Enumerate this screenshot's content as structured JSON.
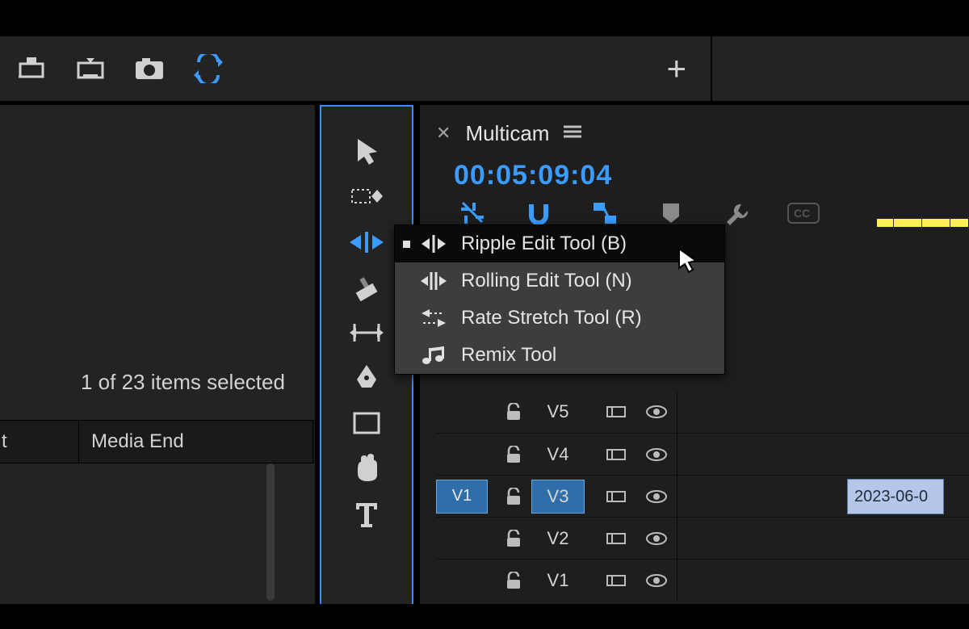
{
  "topbar": {
    "icons": [
      "export-marker-icon",
      "export-frame-icon",
      "camera-icon",
      "swap-icon"
    ],
    "plus": "+"
  },
  "project_panel": {
    "selection_text": "1 of 23 items selected",
    "columns": {
      "col1": "t",
      "col2": "Media End"
    }
  },
  "toolbar": {
    "tools": [
      "selection",
      "track-select",
      "ripple-edit",
      "razor",
      "slip",
      "pen",
      "rectangle",
      "hand",
      "type"
    ],
    "active_index": 2
  },
  "sequence": {
    "tab_title": "Multicam",
    "timecode": "00:05:09:04",
    "header_icons": [
      "insert-overwrite",
      "snap",
      "linked-selection",
      "marker",
      "wrench",
      "captions"
    ]
  },
  "tool_flyout": {
    "items": [
      {
        "label": "Ripple Edit Tool (B)",
        "icon": "ripple-edit-icon",
        "selected": true
      },
      {
        "label": "Rolling Edit Tool (N)",
        "icon": "rolling-edit-icon",
        "selected": false
      },
      {
        "label": "Rate Stretch Tool (R)",
        "icon": "rate-stretch-icon",
        "selected": false
      },
      {
        "label": "Remix Tool",
        "icon": "remix-icon",
        "selected": false
      }
    ]
  },
  "tracks": [
    {
      "src": "",
      "name": "V5",
      "active": false,
      "clip": ""
    },
    {
      "src": "",
      "name": "V4",
      "active": false,
      "clip": ""
    },
    {
      "src": "V1",
      "name": "V3",
      "active": true,
      "clip": "2023-06-0"
    },
    {
      "src": "",
      "name": "V2",
      "active": false,
      "clip": ""
    },
    {
      "src": "",
      "name": "V1",
      "active": false,
      "clip": ""
    }
  ]
}
